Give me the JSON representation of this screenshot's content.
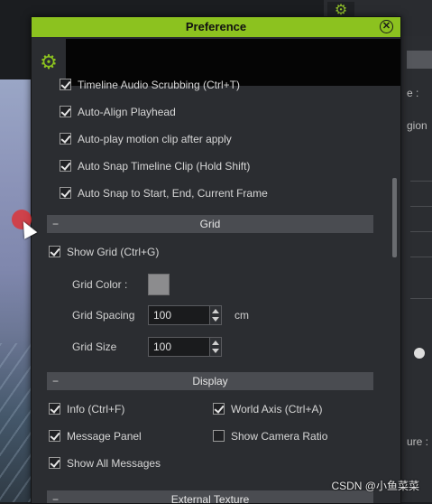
{
  "dialog": {
    "title": "Preference",
    "close_icon": "close-icon",
    "toolbar": {
      "settings_tab_icon": "gear-icon"
    }
  },
  "timeline_options": [
    {
      "label": "Timeline Audio Scrubbing (Ctrl+T)",
      "checked": true
    },
    {
      "label": "Auto-Align Playhead",
      "checked": true
    },
    {
      "label": "Auto-play motion clip after apply",
      "checked": true
    },
    {
      "label": "Auto Snap Timeline Clip (Hold Shift)",
      "checked": true
    },
    {
      "label": "Auto Snap to Start, End, Current Frame",
      "checked": true
    }
  ],
  "grid_section": {
    "title": "Grid",
    "show_grid": {
      "label": "Show Grid (Ctrl+G)",
      "checked": true
    },
    "grid_color_label": "Grid Color :",
    "grid_color_value": "#8c8c8e",
    "grid_spacing_label": "Grid Spacing",
    "grid_spacing_value": "100",
    "grid_spacing_unit": "cm",
    "grid_size_label": "Grid Size",
    "grid_size_value": "100"
  },
  "display_section": {
    "title": "Display",
    "items": [
      {
        "label": "Info (Ctrl+F)",
        "checked": true
      },
      {
        "label": "World Axis (Ctrl+A)",
        "checked": true
      },
      {
        "label": "Message Panel",
        "checked": true
      },
      {
        "label": "Show Camera Ratio",
        "checked": false
      },
      {
        "label": "Show All Messages",
        "checked": true
      }
    ]
  },
  "external_texture_section": {
    "title": "External Texture"
  },
  "background_panel": {
    "text_1": "e :",
    "text_2": "gion",
    "text_3": "ure :"
  },
  "watermark": "CSDN @小鱼菜菜",
  "colors": {
    "accent": "#8cc21f",
    "panel": "#2b2d31",
    "section_bar": "#4a4c51"
  }
}
